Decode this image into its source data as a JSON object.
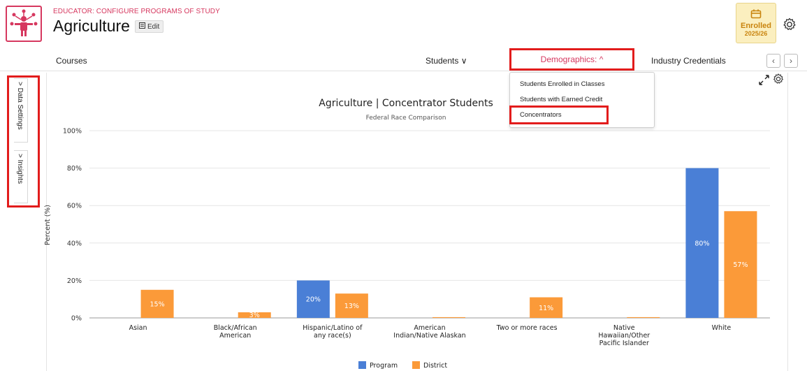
{
  "header": {
    "breadcrumb": "EDUCATOR: CONFIGURE PROGRAMS OF STUDY",
    "title": "Agriculture",
    "edit_label": "Edit",
    "enrolled_label": "Enrolled",
    "enrolled_year": "2025/26"
  },
  "nav": {
    "courses": "Courses",
    "students": "Students ∨",
    "demographics": "Demographics: ^",
    "credentials": "Industry Credentials"
  },
  "dropdown": {
    "items": [
      "Students Enrolled in Classes",
      "Students with Earned Credit",
      "Concentrators"
    ]
  },
  "side_tabs": {
    "data_settings": "> Data Settings",
    "insights": "> Insights"
  },
  "colors": {
    "accent": "#d6385f",
    "highlight": "#e21c1c",
    "program": "#4a7fd6",
    "district": "#fb9a39"
  },
  "chart_data": {
    "type": "bar",
    "title": "Agriculture | Concentrator Students",
    "subtitle": "Federal Race Comparison",
    "ylabel": "Percent (%)",
    "xlabel": "",
    "ylim": [
      0,
      100
    ],
    "yticks": [
      "0%",
      "20%",
      "40%",
      "60%",
      "80%",
      "100%"
    ],
    "categories": [
      [
        "Asian"
      ],
      [
        "Black/African",
        "American"
      ],
      [
        "Hispanic/Latino of",
        "any race(s)"
      ],
      [
        "American",
        "Indian/Native Alaskan"
      ],
      [
        "Two or more races"
      ],
      [
        "Native",
        "Hawaiian/Other",
        "Pacific Islander"
      ],
      [
        "White"
      ]
    ],
    "series": [
      {
        "name": "Program",
        "values": [
          0,
          0,
          20,
          0,
          0,
          0,
          80
        ],
        "labels": [
          "",
          "",
          "20%",
          "",
          "",
          "",
          "80%"
        ]
      },
      {
        "name": "District",
        "values": [
          15,
          3,
          13,
          0.4,
          11,
          0.4,
          57
        ],
        "labels": [
          "15%",
          "3%",
          "13%",
          "",
          "11%",
          "",
          "57%"
        ]
      }
    ],
    "legend": "bottom-center",
    "grid": true
  }
}
